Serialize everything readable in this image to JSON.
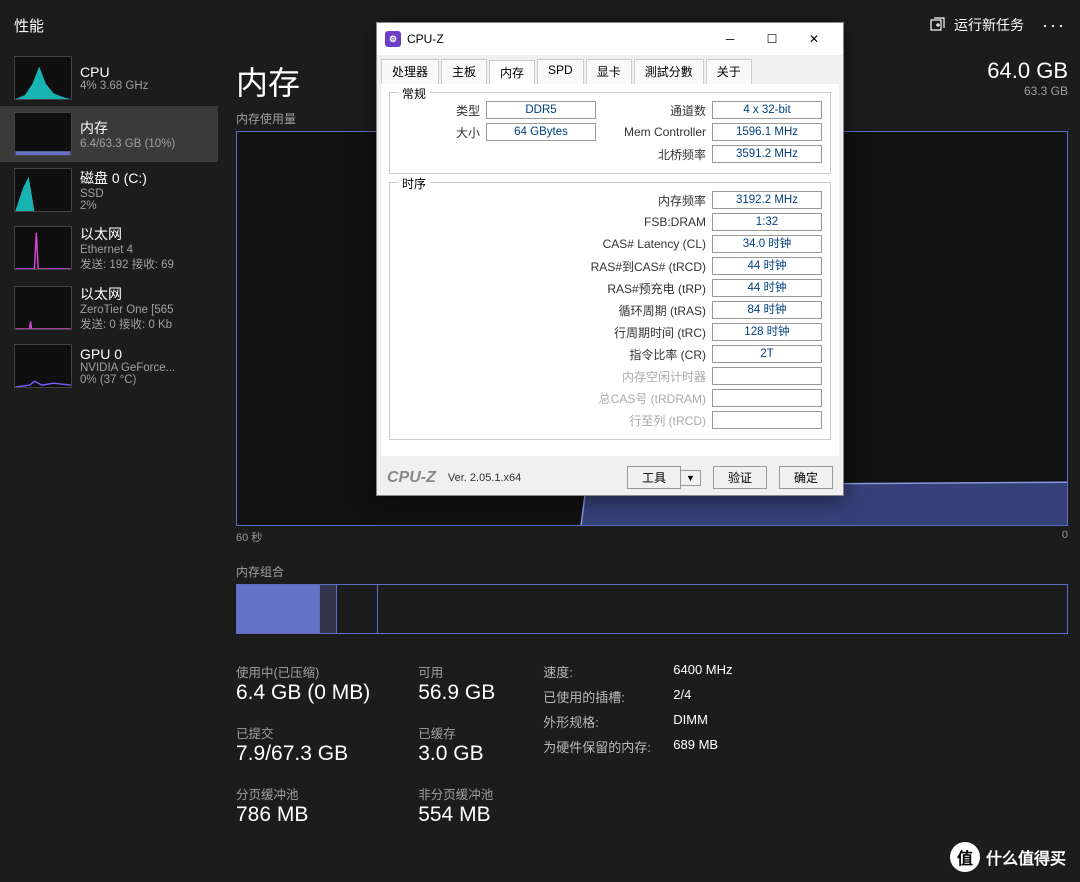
{
  "header": {
    "title": "性能",
    "newtask": "运行新任务"
  },
  "sidebar": [
    {
      "name": "CPU",
      "detail": "4%  3.68 GHz",
      "color": "#1ac5c5"
    },
    {
      "name": "内存",
      "detail": "6.4/63.3 GB (10%)",
      "color": "#6573c5",
      "selected": true
    },
    {
      "name": "磁盘 0 (C:)",
      "detail": "SSD",
      "detail2": "2%",
      "color": "#1ac5c5"
    },
    {
      "name": "以太网",
      "detail": "Ethernet 4",
      "detail2": "发送: 192 接收: 69",
      "color": "#d946d9"
    },
    {
      "name": "以太网",
      "detail": "ZeroTier One [565",
      "detail2": "发送: 0 接收: 0 Kb",
      "color": "#d946d9"
    },
    {
      "name": "GPU 0",
      "detail": "NVIDIA GeForce...",
      "detail2": "0% (37 °C)",
      "color": "#7c5cff"
    }
  ],
  "main": {
    "title": "内存",
    "total": "64.0 GB",
    "totalSub": "63.3 GB",
    "usageLabel": "内存使用量",
    "axisLeft": "60 秒",
    "axisRight": "0",
    "compLabel": "内存组合"
  },
  "stats": {
    "usedLabel": "使用中(已压缩)",
    "used": "6.4 GB (0 MB)",
    "commitLabel": "已提交",
    "commit": "7.9/67.3 GB",
    "pagedLabel": "分页缓冲池",
    "paged": "786 MB",
    "availLabel": "可用",
    "avail": "56.9 GB",
    "cachedLabel": "已缓存",
    "cached": "3.0 GB",
    "nonpagedLabel": "非分页缓冲池",
    "nonpaged": "554 MB",
    "speedK": "速度:",
    "speedV": "6400 MHz",
    "slotsK": "已使用的插槽:",
    "slotsV": "2/4",
    "formK": "外形规格:",
    "formV": "DIMM",
    "reservedK": "为硬件保留的内存:",
    "reservedV": "689 MB"
  },
  "cpuz": {
    "title": "CPU-Z",
    "tabs": [
      "处理器",
      "主板",
      "内存",
      "SPD",
      "显卡",
      "測試分數",
      "关于"
    ],
    "activeTab": 2,
    "groupGeneral": "常规",
    "groupTiming": "时序",
    "general": [
      {
        "lbl": "类型",
        "val": "DDR5"
      },
      {
        "lbl": "大小",
        "val": "64 GBytes"
      },
      {
        "lbl": "通道数",
        "val": "4 x 32-bit"
      },
      {
        "lbl": "Mem Controller",
        "val": "1596.1 MHz"
      },
      {
        "lbl": "北桥频率",
        "val": "3591.2 MHz"
      }
    ],
    "timing": [
      {
        "lbl": "内存频率",
        "val": "3192.2 MHz"
      },
      {
        "lbl": "FSB:DRAM",
        "val": "1:32"
      },
      {
        "lbl": "CAS# Latency (CL)",
        "val": "34.0 时钟"
      },
      {
        "lbl": "RAS#到CAS# (tRCD)",
        "val": "44 时钟"
      },
      {
        "lbl": "RAS#预充电 (tRP)",
        "val": "44 时钟"
      },
      {
        "lbl": "循环周期 (tRAS)",
        "val": "84 时钟"
      },
      {
        "lbl": "行周期时间 (tRC)",
        "val": "128 时钟"
      },
      {
        "lbl": "指令比率 (CR)",
        "val": "2T"
      },
      {
        "lbl": "内存空闲计时器",
        "val": "",
        "dis": true
      },
      {
        "lbl": "总CAS号 (tRDRAM)",
        "val": "",
        "dis": true
      },
      {
        "lbl": "行至列 (tRCD)",
        "val": "",
        "dis": true
      }
    ],
    "logo": "CPU-Z",
    "ver": "Ver. 2.05.1.x64",
    "tools": "工具",
    "verify": "验证",
    "ok": "确定"
  },
  "watermark": {
    "icon": "值",
    "text": "什么值得买"
  }
}
